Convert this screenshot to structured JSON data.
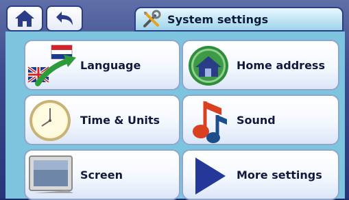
{
  "header": {
    "title": "System settings",
    "home_icon": "home-icon",
    "back_icon": "back-arrow-icon",
    "title_icon": "tools-icon"
  },
  "menu": {
    "language": {
      "label": "Language",
      "icon": "flags-arrow-icon"
    },
    "home_address": {
      "label": "Home address",
      "icon": "house-globe-icon"
    },
    "time_units": {
      "label": "Time & Units",
      "icon": "clock-icon"
    },
    "sound": {
      "label": "Sound",
      "icon": "music-note-icon"
    },
    "screen": {
      "label": "Screen",
      "icon": "monitor-icon"
    },
    "more_settings": {
      "label": "More settings",
      "icon": "play-arrow-icon"
    }
  },
  "colors": {
    "frame": "#2b3d86",
    "accent": "#7dc4df",
    "tile_text": "#13193c"
  }
}
